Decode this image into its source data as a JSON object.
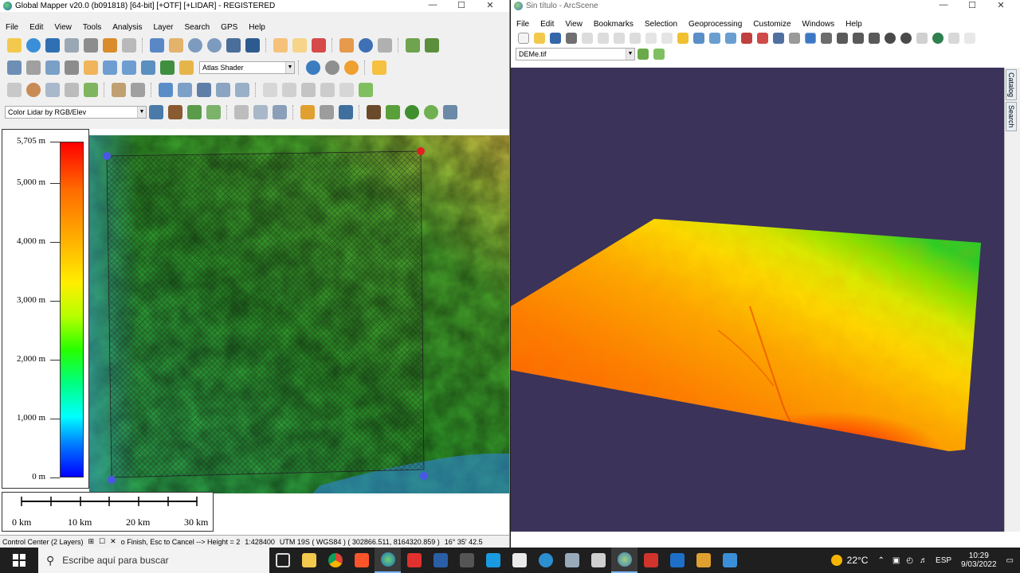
{
  "global_mapper": {
    "title": "Global Mapper v20.0 (b091818) [64-bit] [+OTF] [+LIDAR] - REGISTERED",
    "menu": [
      "File",
      "Edit",
      "View",
      "Tools",
      "Analysis",
      "Layer",
      "Search",
      "GPS",
      "Help"
    ],
    "shader_combo": "Atlas Shader",
    "lidar_combo": "Color Lidar by RGB/Elev",
    "legend": {
      "labels": [
        "5,705 m",
        "5,000 m",
        "4,000 m",
        "3,000 m",
        "2,000 m",
        "1,000 m",
        "0 m"
      ],
      "max_m": 5705
    },
    "scale_bar": [
      "0 km",
      "10 km",
      "20 km",
      "30 km"
    ],
    "status": {
      "control_center": "Control Center (2 Layers)",
      "hint": "o Finish, Esc to Cancel --> Height = 2",
      "scale": "1:428400",
      "projection": "UTM 19S ( WGS84 ) ( 302866.511, 8164320.859 )",
      "coords": "16° 35' 42.5"
    }
  },
  "arcscene": {
    "title": "Sin título - ArcScene",
    "menu": [
      "File",
      "Edit",
      "View",
      "Bookmarks",
      "Selection",
      "Geoprocessing",
      "Customize",
      "Windows",
      "Help"
    ],
    "layer_combo": "DEMe.tif",
    "side_tabs": [
      "Catalog",
      "Search"
    ]
  },
  "taskbar": {
    "search_placeholder": "Escribe aquí para buscar",
    "temperature": "22°C",
    "language": "ESP",
    "time": "10:29",
    "date": "9/03/2022"
  }
}
